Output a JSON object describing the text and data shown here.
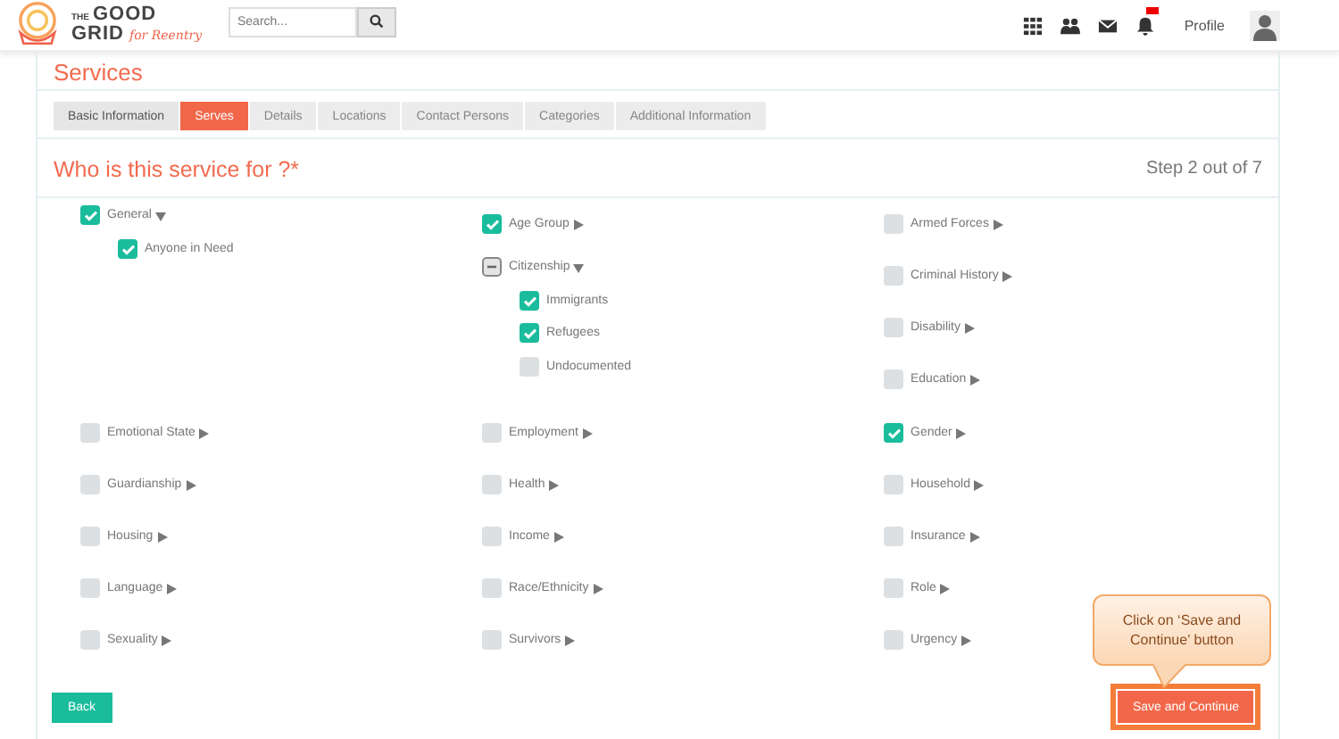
{
  "header": {
    "logo": {
      "top": "THE",
      "line_1": "GOOD",
      "line_2": "GRID",
      "tagline": "for Reentry"
    },
    "search": {
      "placeholder": "Search..."
    },
    "notification_badge": true,
    "profile": "Profile"
  },
  "page_title": "Services",
  "tabs": [
    {
      "label": "Basic Information",
      "selected": false,
      "disabled": false
    },
    {
      "label": "Serves",
      "selected": true,
      "disabled": false
    },
    {
      "label": "Details",
      "selected": false,
      "disabled": true
    },
    {
      "label": "Locations",
      "selected": false,
      "disabled": true
    },
    {
      "label": "Contact Persons",
      "selected": false,
      "disabled": true
    },
    {
      "label": "Categories",
      "selected": false,
      "disabled": true
    },
    {
      "label": "Additional Information",
      "selected": false,
      "disabled": true
    }
  ],
  "question": "Who is this service for ?*",
  "step": "Step 2 out of 7",
  "top_columns": [
    [
      {
        "label": "General",
        "checked": true,
        "expanded": true,
        "children": [
          {
            "label": "Anyone in Need",
            "checked": true
          }
        ]
      }
    ],
    [
      {
        "label": "Age Group",
        "checked": true,
        "expanded": false
      },
      {
        "label": "Citizenship",
        "checked": false,
        "partial": true,
        "expanded": true,
        "children": [
          {
            "label": "Immigrants",
            "checked": true
          },
          {
            "label": "Refugees",
            "checked": true
          },
          {
            "label": "Undocumented",
            "checked": false
          }
        ]
      }
    ],
    [
      {
        "label": "Armed Forces",
        "checked": false,
        "expanded": false
      },
      {
        "label": "Criminal History",
        "checked": false,
        "expanded": false
      },
      {
        "label": "Disability",
        "checked": false,
        "expanded": false
      },
      {
        "label": "Education",
        "checked": false,
        "expanded": false
      }
    ]
  ],
  "grid_items": [
    {
      "label": "Emotional State",
      "checked": false,
      "expanded": false
    },
    {
      "label": "Employment",
      "checked": false,
      "expanded": false
    },
    {
      "label": "Gender",
      "checked": true,
      "expanded": false
    },
    {
      "label": "Guardianship",
      "checked": false,
      "expanded": false
    },
    {
      "label": "Health",
      "checked": false,
      "expanded": false
    },
    {
      "label": "Household",
      "checked": false,
      "expanded": false
    },
    {
      "label": "Housing",
      "checked": false,
      "expanded": false
    },
    {
      "label": "Income",
      "checked": false,
      "expanded": false
    },
    {
      "label": "Insurance",
      "checked": false,
      "expanded": false
    },
    {
      "label": "Language",
      "checked": false,
      "expanded": false
    },
    {
      "label": "Race/Ethnicity",
      "checked": false,
      "expanded": false
    },
    {
      "label": "Role",
      "checked": false,
      "expanded": false
    },
    {
      "label": "Sexuality",
      "checked": false,
      "expanded": false
    },
    {
      "label": "Survivors",
      "checked": false,
      "expanded": false
    },
    {
      "label": "Urgency",
      "checked": false,
      "expanded": false
    }
  ],
  "back_button": "Back",
  "save_button": "Save and Continue",
  "callout": "Click on ‘Save and Continue’ button"
}
